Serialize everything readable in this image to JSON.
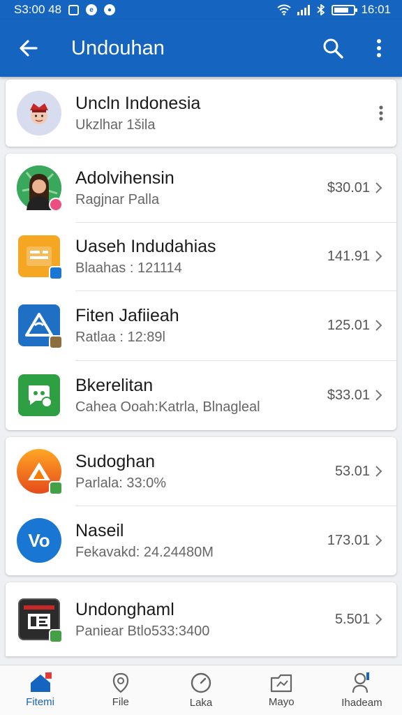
{
  "status_bar": {
    "left": "S3:00 48",
    "time": "16:01"
  },
  "app_bar": {
    "title": "Undouhan",
    "back_icon": "arrow-back-icon",
    "search_icon": "search-icon",
    "more_icon": "more-vert-icon"
  },
  "account": {
    "title": "Uncln Indonesia",
    "subtitle": "Ukzlhar 1šila"
  },
  "group1": [
    {
      "title": "Adolvihensin",
      "subtitle": "Ragjnar Palla",
      "value": "$30.01"
    },
    {
      "title": "Uaseh Indudahias",
      "subtitle": "Blaahas : 121114",
      "value": "141.91"
    },
    {
      "title": "Fiten Jafiieah",
      "subtitle": "Ratlaa : 12:89l",
      "value": "125.01"
    },
    {
      "title": "Bkerelitan",
      "subtitle": "Cahea Ooah:Katrla, Blnagleal",
      "value": "$33.01"
    }
  ],
  "group2": [
    {
      "title": "Sudoghan",
      "subtitle": "Parlala: 33:0%",
      "value": "53.01"
    },
    {
      "title": "Naseil",
      "subtitle": "Fekavakd: 24.24480M",
      "value": "173.01"
    }
  ],
  "group3": [
    {
      "title": "Undonghaml",
      "subtitle": "Paniear Btlo533:3400",
      "value": "5.501"
    }
  ],
  "bottom_nav": [
    {
      "label": "Fitemi",
      "icon": "home-icon",
      "active": true
    },
    {
      "label": "File",
      "icon": "location-pin-icon"
    },
    {
      "label": "Laka",
      "icon": "clock-icon"
    },
    {
      "label": "Mayo",
      "icon": "folder-icon"
    },
    {
      "label": "Ihadeam",
      "icon": "person-icon"
    }
  ],
  "colors": {
    "primary": "#1565c0",
    "background": "#eef0f3",
    "nav_badge": "#e53935"
  }
}
